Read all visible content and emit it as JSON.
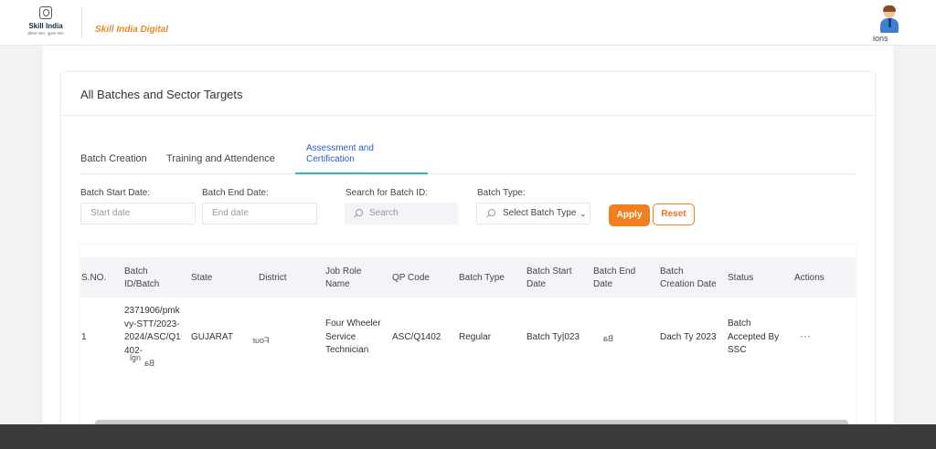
{
  "header": {
    "logo_brand": "Skill India",
    "logo_tag": "कौशल भारत - कुशल भारत",
    "portal_name": "Skill India Digital",
    "user_label": "ions"
  },
  "panel": {
    "title": "All Batches and Sector Targets"
  },
  "tabs": [
    {
      "label": "Batch Creation",
      "active": false
    },
    {
      "label": "Training and Attendence",
      "active": false
    },
    {
      "label": "Assessment and Certification",
      "active": true
    }
  ],
  "filters": {
    "start_date_label": "Batch Start Date:",
    "start_date_placeholder": "Start date",
    "end_date_label": "Batch End Date:",
    "end_date_placeholder": "End date",
    "search_label": "Search for Batch ID:",
    "search_placeholder": "Search",
    "batch_type_label": "Batch Type:",
    "batch_type_value": "Select Batch Type",
    "apply_label": "Apply",
    "reset_label": "Reset"
  },
  "table": {
    "columns": [
      "S.NO.",
      "Batch ID/Batch",
      "State",
      "District",
      "Job Role Name",
      "QP Code",
      "Batch Type",
      "Batch Start Date",
      "Batch End Date",
      "Batch Creation Date",
      "Status",
      "Actions"
    ],
    "rows": [
      {
        "sno": "1",
        "batch_id": "2371906/pmkvy-STT/2023-2024/ASC/Q1402-",
        "state": "GUJARAT",
        "district": "Four",
        "job_role": "Four Wheeler Service Technician",
        "qp_code": "ASC/Q1402",
        "batch_type": "Regular",
        "start_date": "Batch Ty|023",
        "end_date": "Ba",
        "creation_date": "Dach Ty 2023",
        "status": "Batch Accepted By SSC",
        "actions": "···"
      }
    ]
  },
  "colors": {
    "accent_orange": "#f07f21",
    "tab_active": "#2a5cc9",
    "tab_underline": "#3ab5b0"
  }
}
